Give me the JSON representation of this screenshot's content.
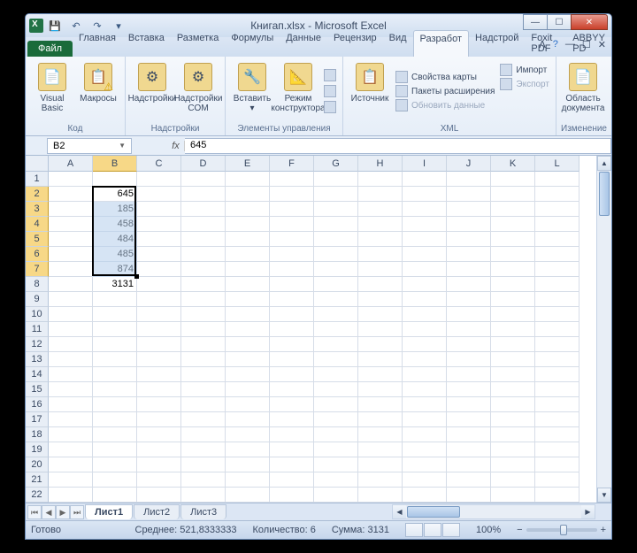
{
  "title": "Книгап.xlsx - Microsoft Excel",
  "qat": {
    "save": "💾",
    "undo": "↶",
    "redo": "↷"
  },
  "tabs": {
    "file": "Файл",
    "items": [
      "Главная",
      "Вставка",
      "Разметка",
      "Формулы",
      "Данные",
      "Рецензир",
      "Вид",
      "Разработ",
      "Надстрой",
      "Foxit PDF",
      "ABBYY PD"
    ],
    "active_index": 7
  },
  "ribbon": {
    "group1": {
      "label": "Код",
      "btn1_l1": "Visual",
      "btn1_l2": "Basic",
      "btn2": "Макросы"
    },
    "group2": {
      "label": "Надстройки",
      "btn1": "Надстройки",
      "btn2_l1": "Надстройки",
      "btn2_l2": "COM"
    },
    "group3": {
      "label": "Элементы управления",
      "btn1": "Вставить",
      "btn2_l1": "Режим",
      "btn2_l2": "конструктора"
    },
    "group4": {
      "label": "XML",
      "btn": "Источник",
      "r1": "Свойства карты",
      "r2": "Пакеты расширения",
      "r3": "Обновить данные",
      "r4": "Импорт",
      "r5": "Экспорт"
    },
    "group5": {
      "label": "Изменение",
      "btn_l1": "Область",
      "btn_l2": "документа"
    }
  },
  "namebox": "B2",
  "formula": "645",
  "columns": [
    "A",
    "B",
    "C",
    "D",
    "E",
    "F",
    "G",
    "H",
    "I",
    "J",
    "K",
    "L"
  ],
  "selected_col_index": 1,
  "rows": 23,
  "selected_rows": [
    2,
    3,
    4,
    5,
    6,
    7
  ],
  "cell_values": {
    "B2": "645",
    "B3": "185",
    "B4": "458",
    "B5": "484",
    "B6": "485",
    "B7": "874",
    "B8": "3131"
  },
  "sheets": {
    "items": [
      "Лист1",
      "Лист2",
      "Лист3"
    ],
    "active": 0
  },
  "status": {
    "ready": "Готово",
    "avg": "Среднее: 521,8333333",
    "count": "Количество: 6",
    "sum": "Сумма: 3131",
    "zoom": "100%"
  }
}
